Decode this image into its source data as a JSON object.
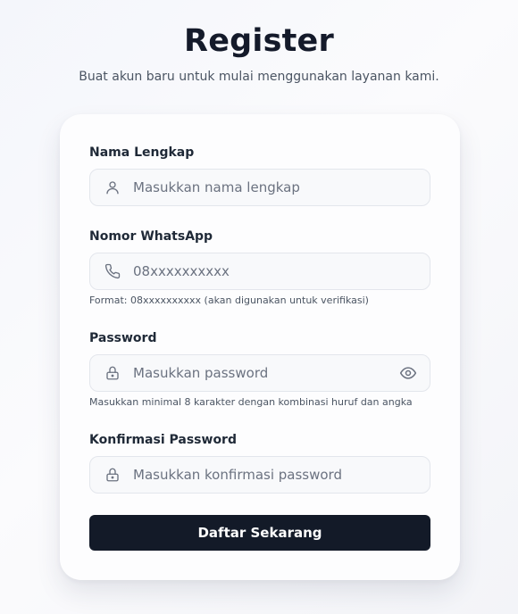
{
  "header": {
    "title": "Register",
    "subtitle": "Buat akun baru untuk mulai menggunakan layanan kami."
  },
  "form": {
    "full_name": {
      "label": "Nama Lengkap",
      "placeholder": "Masukkan nama lengkap",
      "value": "",
      "icon": "user-icon"
    },
    "whatsapp": {
      "label": "Nomor WhatsApp",
      "placeholder": "08xxxxxxxxxx",
      "value": "",
      "icon": "phone-icon",
      "hint": "Format: 08xxxxxxxxxx (akan digunakan untuk verifikasi)"
    },
    "password": {
      "label": "Password",
      "placeholder": "Masukkan password",
      "value": "",
      "icon": "lock-icon",
      "toggle_icon": "eye-icon",
      "hint": "Masukkan minimal 8 karakter dengan kombinasi huruf dan angka"
    },
    "confirm_password": {
      "label": "Konfirmasi Password",
      "placeholder": "Masukkan konfirmasi password",
      "value": "",
      "icon": "lock-icon"
    },
    "submit_label": "Daftar Sekarang"
  },
  "colors": {
    "primary_button": "#131a28",
    "title": "#141a2a",
    "icon": "#6b7280"
  }
}
